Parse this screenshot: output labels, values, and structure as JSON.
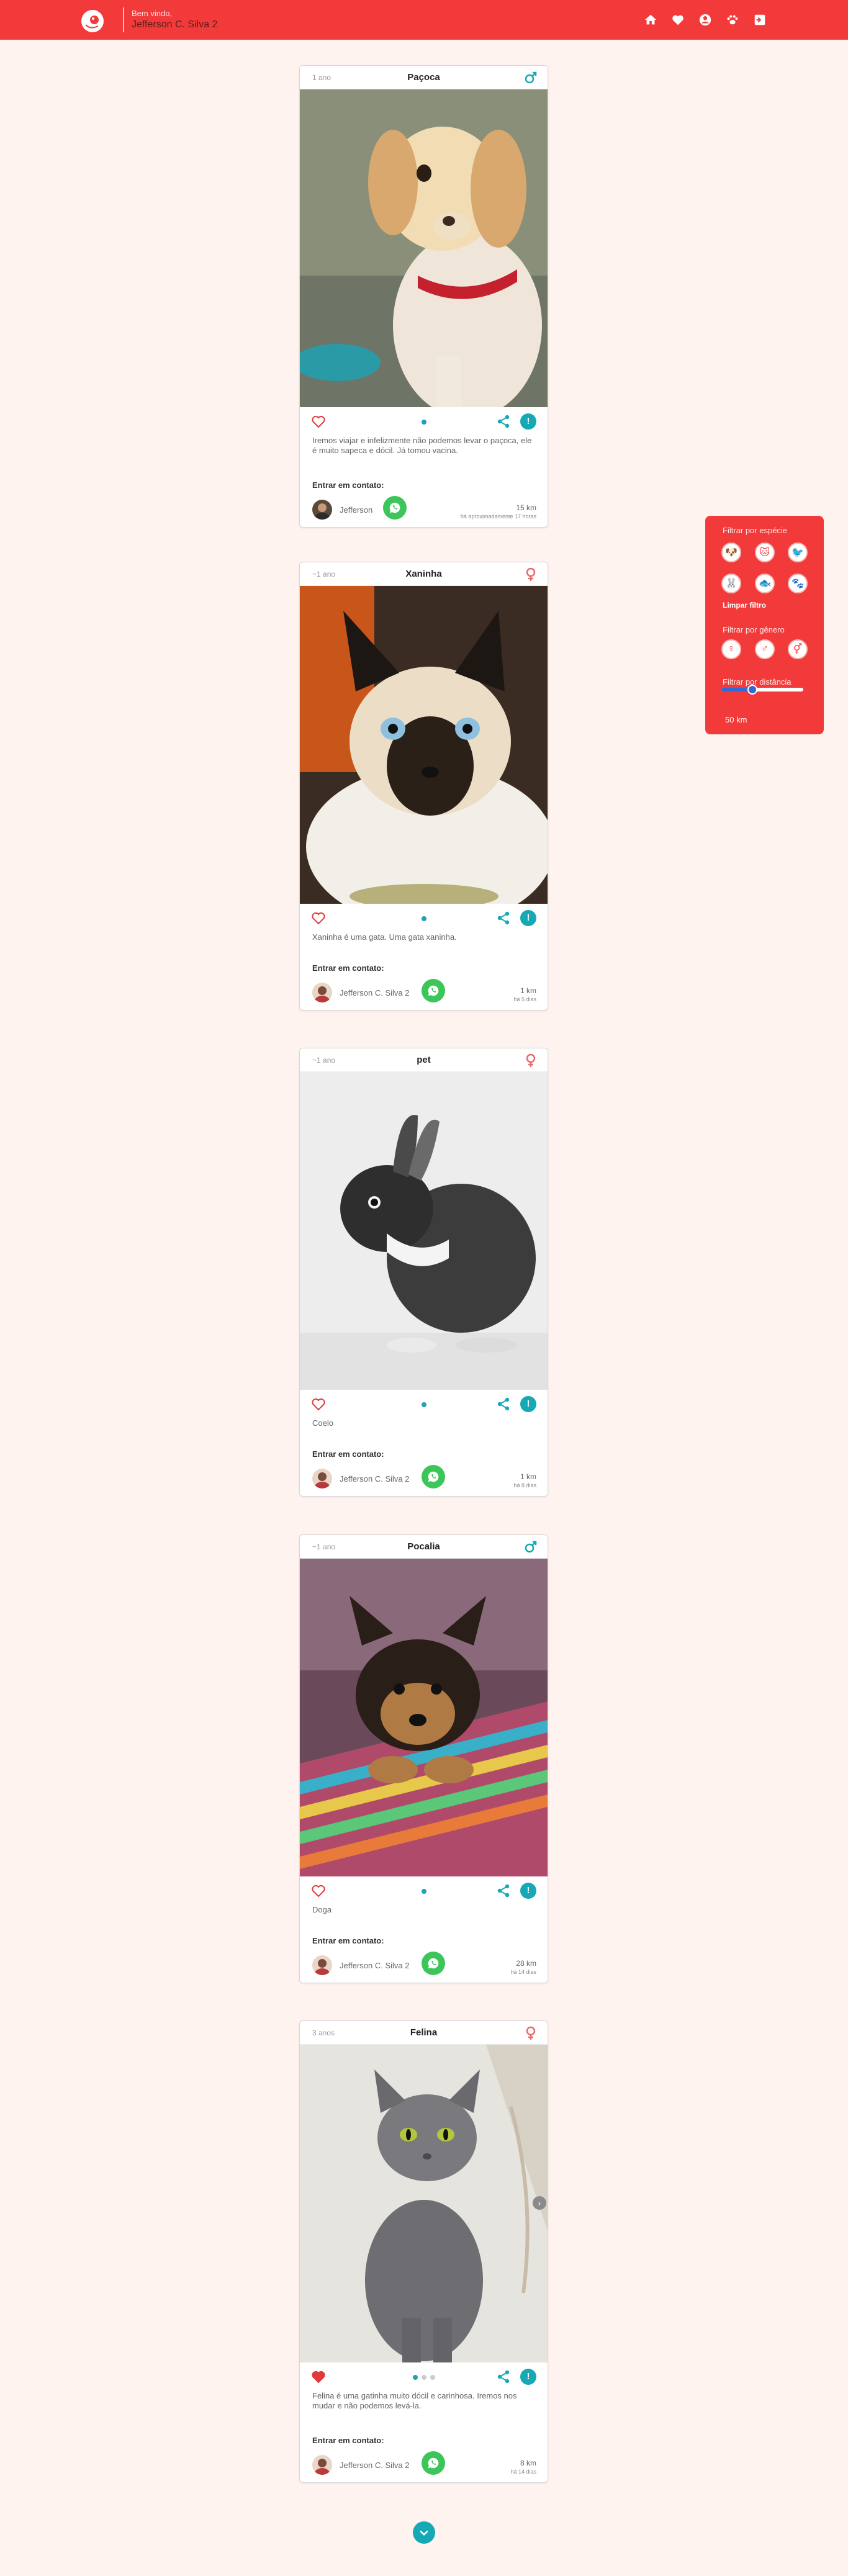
{
  "header": {
    "welcome": "Bem vindo,",
    "username": "Jefferson C. Silva 2",
    "nav": [
      "home-icon",
      "heart-icon",
      "user-circle-icon",
      "paw-icon",
      "logout-icon"
    ],
    "color": "#f23a3a"
  },
  "posts": [
    {
      "age": "1 ano",
      "name": "Paçoca",
      "gender": "male",
      "description": "Iremos viajar e infelizmente não podemos levar o paçoca, ele é muito sapeca e dócil. Já tomou vacina.",
      "contact_label": "Entrar em contato:",
      "owner": "Jefferson",
      "distance": "15 km",
      "time": "há aproximadamente 17 horas",
      "liked": false,
      "photos": 1
    },
    {
      "age": "~1 ano",
      "name": "Xaninha",
      "gender": "female",
      "description": "Xaninha é uma gata. Uma gata xaninha.",
      "contact_label": "Entrar em contato:",
      "owner": "Jefferson C. Silva 2",
      "distance": "1 km",
      "time": "há 5 dias",
      "liked": false,
      "photos": 1
    },
    {
      "age": "~1 ano",
      "name": "pet",
      "gender": "female",
      "description": "Coelo",
      "contact_label": "Entrar em contato:",
      "owner": "Jefferson C. Silva 2",
      "distance": "1 km",
      "time": "há 8 dias",
      "liked": false,
      "photos": 1
    },
    {
      "age": "~1 ano",
      "name": "Pocalia",
      "gender": "male",
      "description": "Doga",
      "contact_label": "Entrar em contato:",
      "owner": "Jefferson C. Silva 2",
      "distance": "28 km",
      "time": "há 14 dias",
      "liked": false,
      "photos": 1
    },
    {
      "age": "3 anos",
      "name": "Felina",
      "gender": "female",
      "description": "Felina é uma gatinha muito dócil e carinhosa. Iremos nos mudar e não podemos levá-la.",
      "contact_label": "Entrar em contato:",
      "owner": "Jefferson C. Silva 2",
      "distance": "8 km",
      "time": "há 14 dias",
      "liked": true,
      "photos": 3
    }
  ],
  "filter": {
    "species_title": "Filtrar por espécie",
    "species_icons": [
      "dog-icon",
      "cat-icon",
      "bird-icon",
      "rabbit-icon",
      "fish-icon",
      "paw-icon"
    ],
    "clear": "Limpar filtro",
    "gender_title": "Filtrar por gênero",
    "gender_icons": [
      "female-icon",
      "male-icon",
      "both-genders-icon"
    ],
    "distance_title": "Filtrar por distância",
    "distance": "50 km",
    "distance_fraction": 0.38
  },
  "colors": {
    "accent": "#16a8b4",
    "whatsapp": "#3cc65a",
    "red": "#f23a3a"
  }
}
